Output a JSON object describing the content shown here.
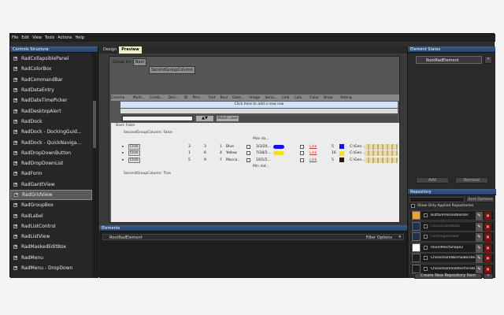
{
  "menu": [
    "File",
    "Edit",
    "View",
    "Tools",
    "Actions",
    "Help"
  ],
  "controls_structure": {
    "title": "Controls Structure",
    "items": [
      "RadCollapsiblePanel",
      "RadColorBox",
      "RadCommandBar",
      "RadDataEntry",
      "RadDateTimePicker",
      "RadDesktopAlert",
      "RadDock",
      "RadDock  -  DockingGuid...",
      "RadDock  -  QuickNaviga...",
      "RadDropDownButton",
      "RadDropDownList",
      "RadForm",
      "RadGanttView",
      "RadGridView",
      "RadGroupBox",
      "RadLabel",
      "RadListControl",
      "RadListView",
      "RadMaskedEditBox",
      "RadMenu",
      "RadMenu  -  DropDown"
    ]
  },
  "center": {
    "tabs": [
      "Design",
      "Preview"
    ],
    "group_by_label": "Group by:",
    "group_chip1": "Bool",
    "group_chip2": "SecondGroupColumn",
    "headers": [
      "Comma...",
      "Multi...",
      "Comb...",
      "Deci...",
      "ID",
      "Perc...",
      "Text",
      "Bool",
      "Date...",
      "Image",
      "Seria...",
      "Link",
      "Calc...",
      "Color",
      "Brow...",
      "Rating"
    ],
    "add_row": "Click here to add a new row",
    "match_case": "Match case",
    "group_bool_false": "Bool: False",
    "group_second_false": "SecondGroupColumn: False",
    "group_second_true": "SecondGroupColumn: True",
    "max_label": "Max da...",
    "min_label": "Min dat...",
    "rows": [
      {
        "cmd": "Click",
        "dec": "3",
        "id": "3",
        "perc": "1",
        "text": "Blue",
        "date": "3/3/20...",
        "link": "Link",
        "calc": "5",
        "path": "C:\\Gen..."
      },
      {
        "cmd": "Click",
        "dec": "1",
        "id": "6",
        "perc": "4",
        "text": "Yellow",
        "date": "7/28/2...",
        "link": "Link",
        "calc": "16",
        "path": "C:\\Gen..."
      },
      {
        "cmd": "Click",
        "dec": "5",
        "id": "9",
        "perc": "7",
        "text": "Mocca...",
        "date": "10/2/2...",
        "link": "Link",
        "calc": "5",
        "path": "C:\\Gen..."
      }
    ]
  },
  "elements": {
    "title": "Elements",
    "root": "RootRadElement",
    "filter": "Filter Options"
  },
  "element_states": {
    "title": "Element States",
    "item": "RootRadElement",
    "add": "Add",
    "remove": "Remove"
  },
  "repository": {
    "title": "Repository",
    "sort": "Sort Options",
    "show_only": "Show Only Applied Repositories",
    "items": [
      {
        "label": "ButtonPressedBorder",
        "color": "#e8a23a",
        "dim": false
      },
      {
        "label": "FocusColorBlack",
        "color": "#203050",
        "dim": true
      },
      {
        "label": "FontSegoeUISet",
        "color": "#203050",
        "dim": true
      },
      {
        "label": "RoundRectShape2",
        "color": "#ffffff",
        "dim": false
      },
      {
        "label": "CheckmarkNormalBorder",
        "color": "#1d1d1d",
        "dim": false
      },
      {
        "label": "CheckmarkIndeterminate...",
        "color": "#1d1d1d",
        "dim": false
      }
    ],
    "create": "Create New Repository Item"
  }
}
